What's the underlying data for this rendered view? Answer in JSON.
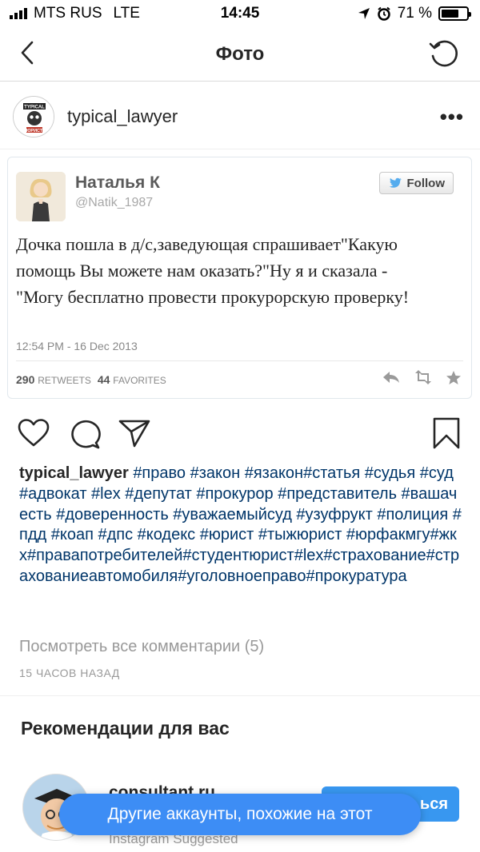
{
  "status_bar": {
    "carrier": "MTS RUS",
    "network": "LTE",
    "time": "14:45",
    "battery_percent": "71 %",
    "battery_level": 0.71
  },
  "nav": {
    "title": "Фото",
    "back_icon": "chevron-left-icon",
    "refresh_icon": "refresh-icon"
  },
  "post": {
    "username": "typical_lawyer",
    "avatar_text_top": "TYPICAL",
    "avatar_text_bottom": "ЮРИСТ",
    "more_label": "•••"
  },
  "tweet": {
    "name": "Наталья К",
    "handle": "@Natik_1987",
    "follow_label": "Follow",
    "text": "Дочка пошла в д/с,заведующая спрашивает\"Какую помощь Вы можете нам оказать?\"Ну я и сказала - \"Могу бесплатно провести прокурорскую проверку!",
    "date": "12:54 PM - 16 Dec 2013",
    "retweets_count": "290",
    "retweets_label": "RETWEETS",
    "favorites_count": "44",
    "favorites_label": "FAVORITES"
  },
  "caption": {
    "username": "typical_lawyer",
    "text": "#право #закон #язакон#статья #судья #суд #адвокат #lex #депутат #прокурор #представитель #вашачесть #доверенность #уважаемыйсуд #узуфрукт #полиция #пдд #коап #дпс #кодекс #юрист #тыжюрист #юрфакмгу#жкх#правапотребителей#студентюрист#lex#страхование#страхованиеавтомобиля#уголовноеправо#прокуратура"
  },
  "comments_link": "Посмотреть все комментарии (5)",
  "time_ago": "15 ЧАСОВ НАЗАД",
  "recommendations": {
    "title": "Рекомендации для вас",
    "account_name": "consultant.ru",
    "account_sub": "Instagram Suggested",
    "follow_button": "ься"
  },
  "toast": "Другие аккаунты, похожие на этот",
  "colors": {
    "accent": "#3897f0",
    "hashtag": "#003569",
    "muted": "#999999"
  }
}
